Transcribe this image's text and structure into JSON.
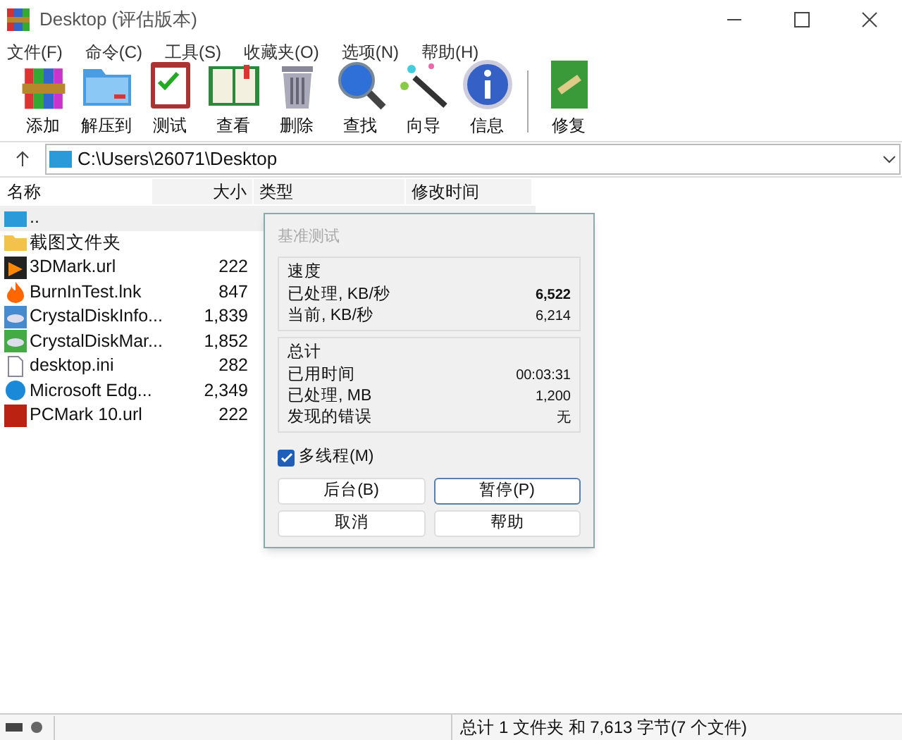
{
  "window": {
    "title": "Desktop (评估版本)"
  },
  "menu": [
    "文件(F)",
    "命令(C)",
    "工具(S)",
    "收藏夹(O)",
    "选项(N)",
    "帮助(H)"
  ],
  "toolbar": [
    {
      "kind": "add",
      "label": "添加"
    },
    {
      "kind": "extract",
      "label": "解压到"
    },
    {
      "kind": "test",
      "label": "测试"
    },
    {
      "kind": "view",
      "label": "查看"
    },
    {
      "kind": "delete",
      "label": "删除"
    },
    {
      "kind": "find",
      "label": "查找"
    },
    {
      "kind": "wizard",
      "label": "向导"
    },
    {
      "kind": "info",
      "label": "信息"
    },
    {
      "kind": "separator"
    },
    {
      "kind": "repair",
      "label": "修复"
    }
  ],
  "address": {
    "path": "C:\\Users\\26071\\Desktop"
  },
  "table": {
    "columns": [
      "名称",
      "大小",
      "类型",
      "修改时间"
    ],
    "rows": [
      {
        "kind": "up",
        "name": "..",
        "size": "",
        "selected": true
      },
      {
        "kind": "folder",
        "name": "截图文件夹",
        "size": "",
        "selected": false
      },
      {
        "kind": "benchmark",
        "name": "3DMark.url",
        "size": "222",
        "selected": false
      },
      {
        "kind": "flame",
        "name": "BurnInTest.lnk",
        "size": "847",
        "selected": false
      },
      {
        "kind": "disk",
        "name": "CrystalDiskInfo...",
        "size": "1,839",
        "selected": false
      },
      {
        "kind": "diskmark",
        "name": "CrystalDiskMar...",
        "size": "1,852",
        "selected": false
      },
      {
        "kind": "ini",
        "name": "desktop.ini",
        "size": "282",
        "selected": false
      },
      {
        "kind": "edge",
        "name": "Microsoft Edg...",
        "size": "2,349",
        "selected": false
      },
      {
        "kind": "pcmark",
        "name": "PCMark 10.url",
        "size": "222",
        "selected": false
      }
    ]
  },
  "dialog": {
    "title": "基准测试",
    "groups": [
      {
        "title": "速度",
        "rows": [
          {
            "label": "已处理, KB/秒",
            "value": "6,522",
            "bold": true
          },
          {
            "label": "当前, KB/秒",
            "value": "6,214",
            "bold": false
          }
        ]
      },
      {
        "title": "总计",
        "rows": [
          {
            "label": "已用时间",
            "value": "00:03:31",
            "bold": false
          },
          {
            "label": "已处理, MB",
            "value": "1,200",
            "bold": false
          },
          {
            "label": "发现的错误",
            "value": "无",
            "bold": false
          }
        ]
      }
    ],
    "checkbox": {
      "label": "多线程(M)",
      "checked": true
    },
    "buttons": [
      {
        "label": "后台(B)",
        "focused": false
      },
      {
        "label": "暂停(P)",
        "focused": true
      },
      {
        "label": "取消",
        "focused": false
      },
      {
        "label": "帮助",
        "focused": false
      }
    ]
  },
  "status_bar": {
    "text": "总计 1 文件夹 和 7,613 字节(7 个文件)"
  }
}
